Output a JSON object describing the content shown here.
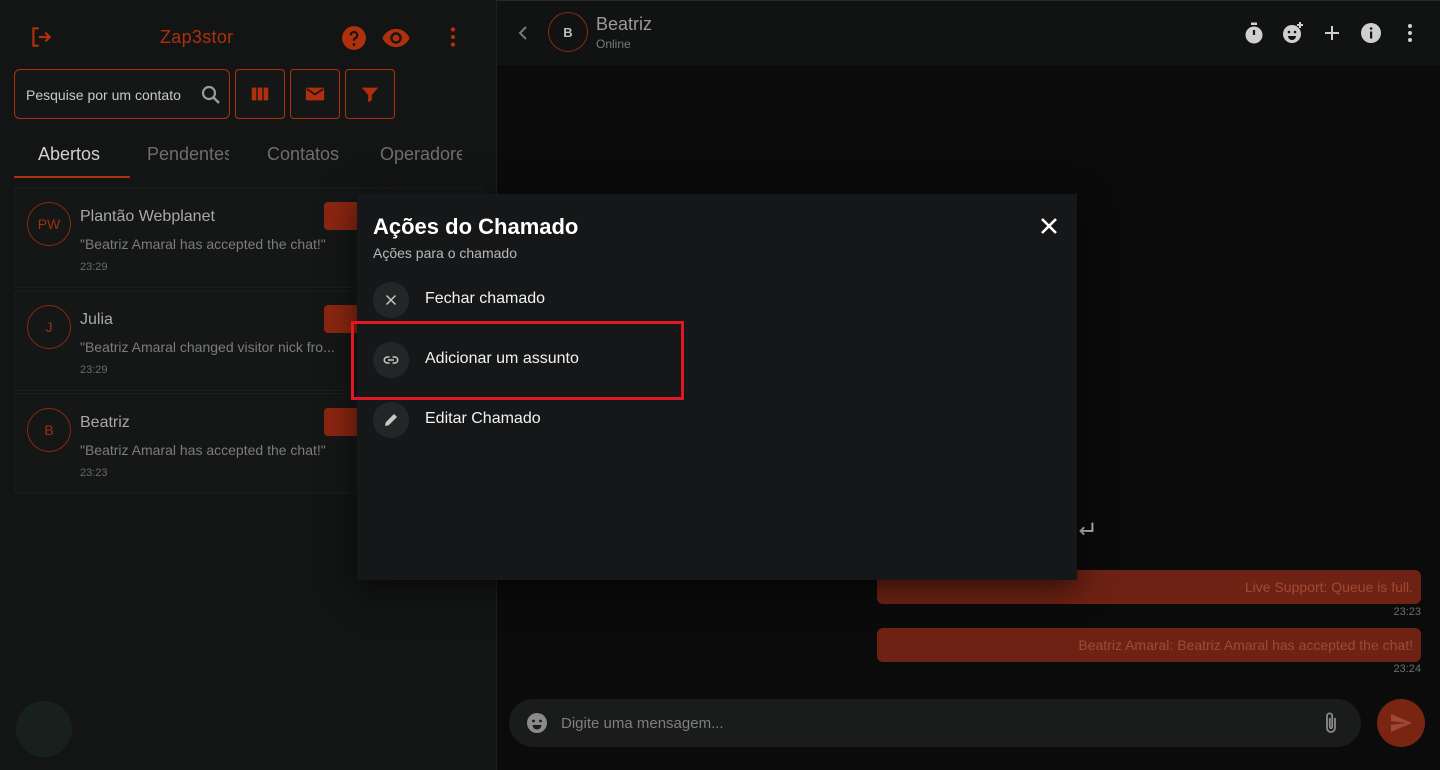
{
  "sidebar": {
    "brand": "Zap3stor",
    "search_placeholder": "Pesquise por um contato",
    "tabs": [
      {
        "label": "Abertos",
        "active": true
      },
      {
        "label": "Pendentes",
        "active": false
      },
      {
        "label": "Contatos",
        "active": false
      },
      {
        "label": "Operadores",
        "active": false
      }
    ],
    "chats": [
      {
        "initials": "PW",
        "name": "Plantão Webplanet",
        "preview": "\"Beatriz Amaral has accepted the chat!\"",
        "time": "23:29"
      },
      {
        "initials": "J",
        "name": "Julia",
        "preview": "\"Beatriz Amaral changed visitor nick fro...",
        "time": "23:29"
      },
      {
        "initials": "B",
        "name": "Beatriz",
        "preview": "\"Beatriz Amaral has accepted the chat!\"",
        "time": "23:23"
      }
    ]
  },
  "chat": {
    "contact": {
      "initials": "B",
      "name": "Beatriz",
      "status": "Online"
    },
    "messages": [
      {
        "text": "Live Support: Queue is full.",
        "time": "23:23"
      },
      {
        "text": "Beatriz Amaral: Beatriz Amaral has accepted the chat!",
        "time": "23:24"
      }
    ],
    "composer_placeholder": "Digite uma mensagem..."
  },
  "modal": {
    "title": "Ações do Chamado",
    "subtitle": "Ações para o chamado",
    "actions": [
      {
        "label": "Fechar chamado",
        "icon": "close-icon"
      },
      {
        "label": "Adicionar um assunto",
        "icon": "link-icon"
      },
      {
        "label": "Editar Chamado",
        "icon": "pencil-icon"
      }
    ]
  },
  "colors": {
    "accent": "#b0300d",
    "message_bubble": "#6e2213",
    "highlight": "#e01822"
  }
}
